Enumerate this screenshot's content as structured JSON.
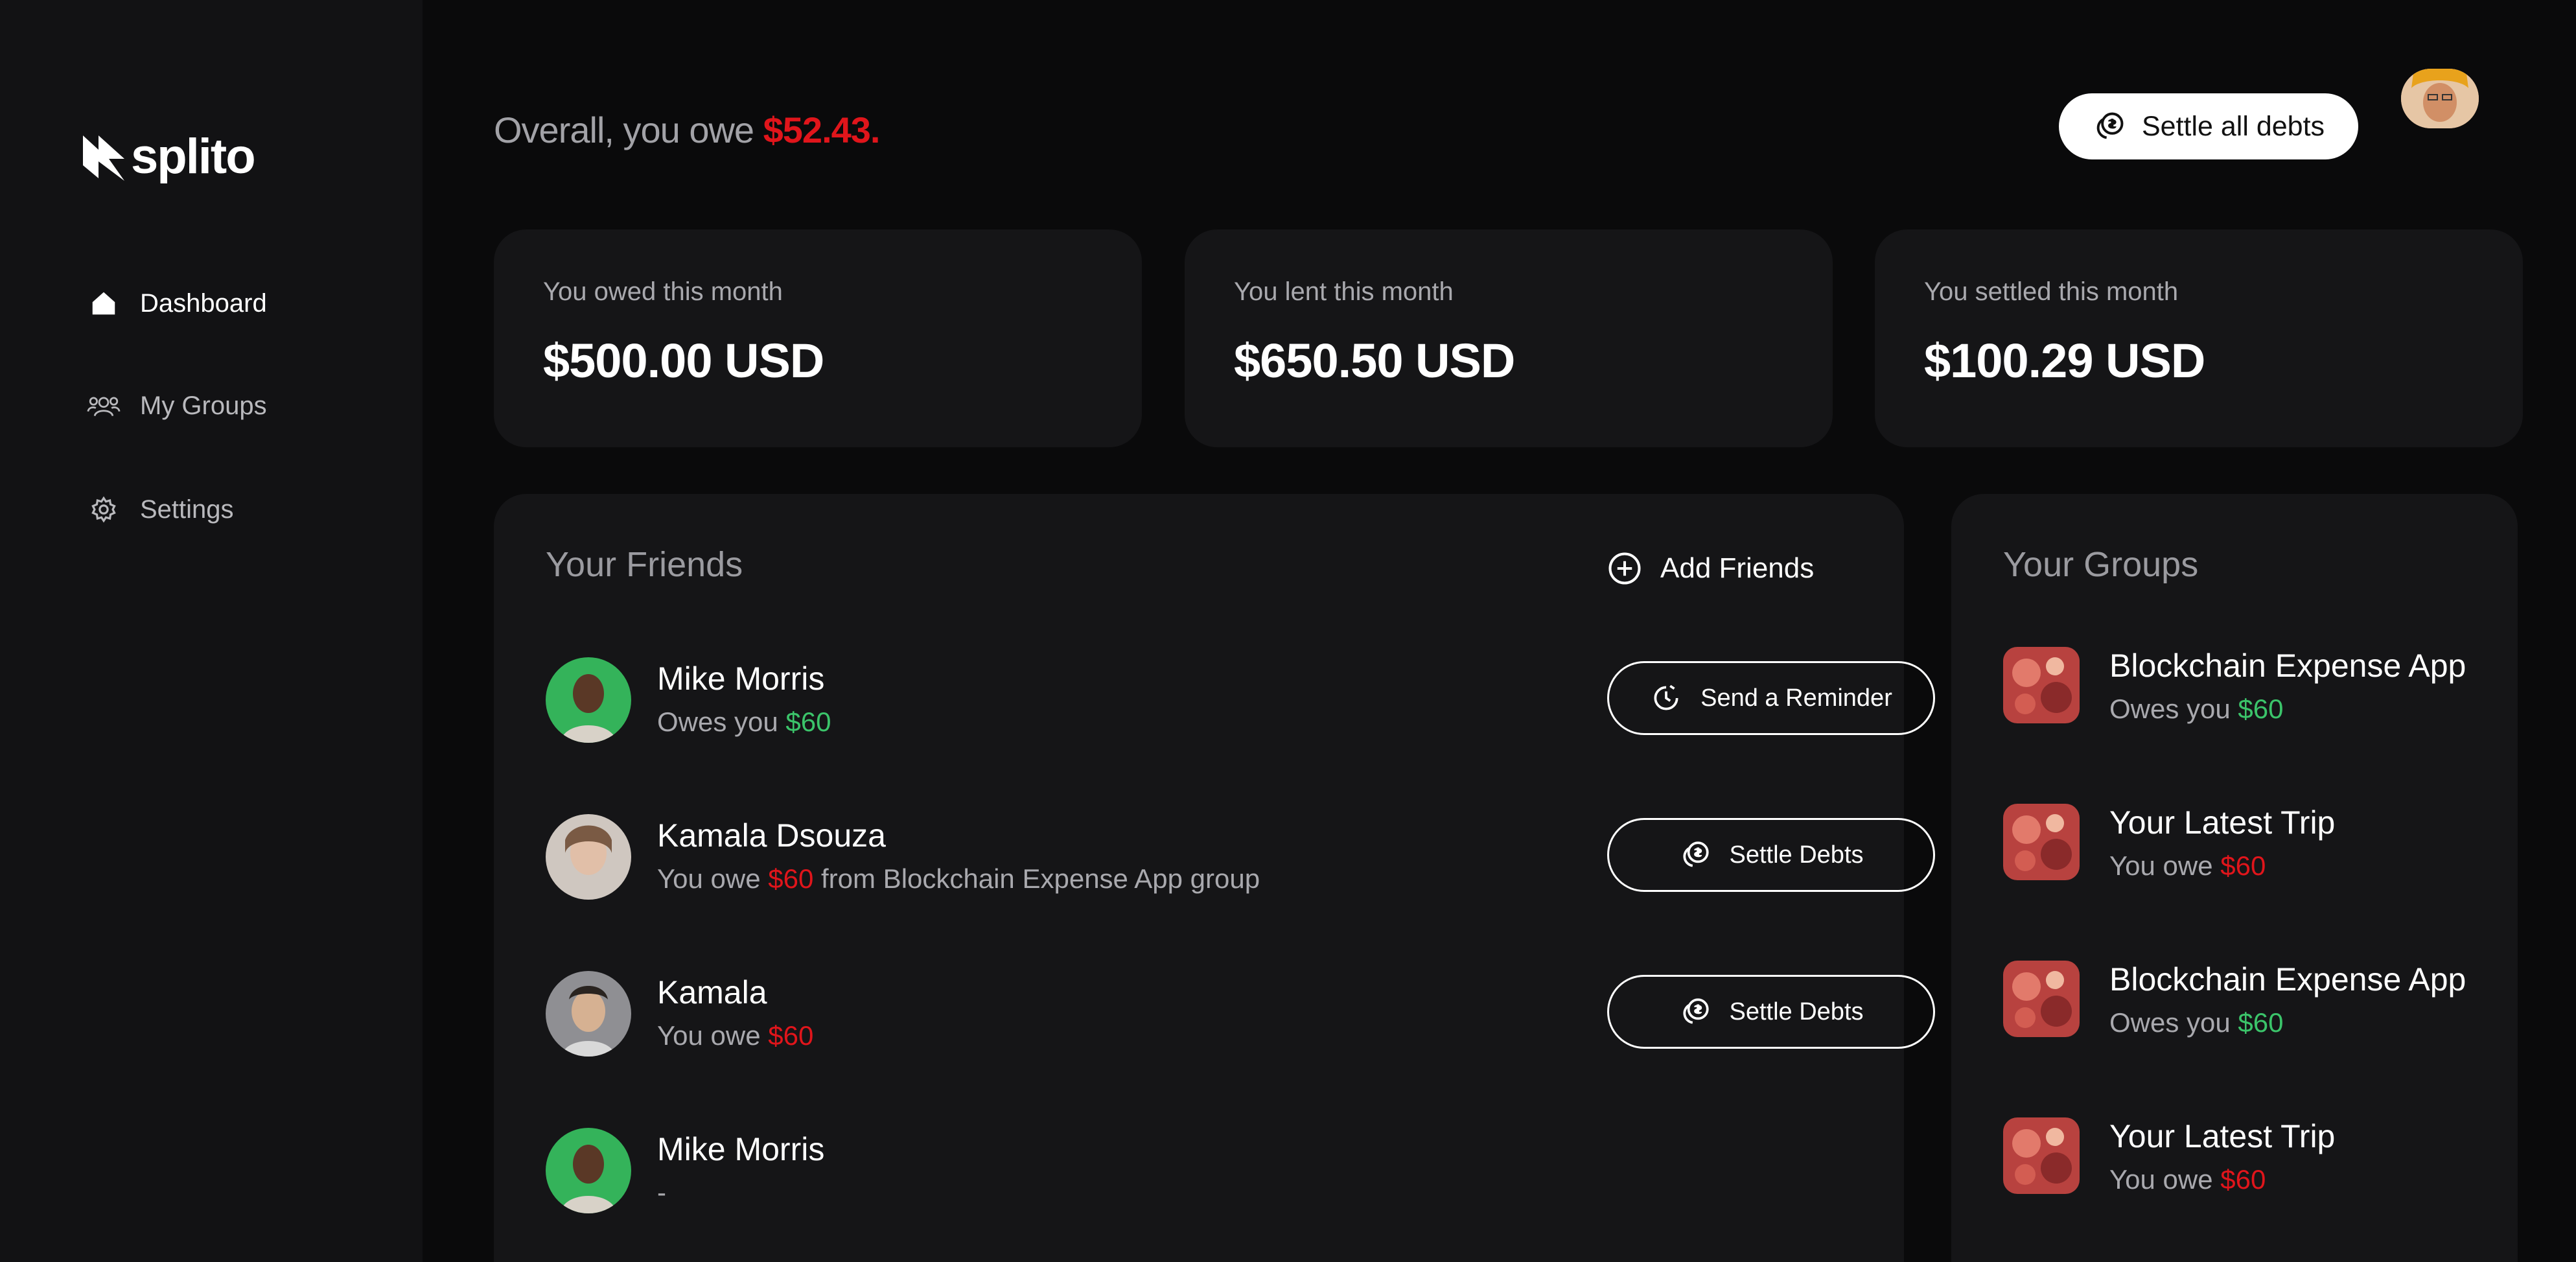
{
  "app": {
    "logo_text": "splito"
  },
  "sidebar": {
    "items": [
      {
        "label": "Dashboard",
        "icon": "home-icon",
        "active": true
      },
      {
        "label": "My Groups",
        "icon": "users-icon",
        "active": false
      },
      {
        "label": "Settings",
        "icon": "gear-icon",
        "active": false
      }
    ]
  },
  "header": {
    "overall_prefix": "Overall, you owe ",
    "overall_amount": "$52.43.",
    "settle_all_label": "Settle all debts",
    "settle_all_icon": "coins-icon"
  },
  "stats": [
    {
      "label": "You owed this month",
      "value": "$500.00 USD"
    },
    {
      "label": "You lent this month",
      "value": "$650.50 USD"
    },
    {
      "label": "You settled this month",
      "value": "$100.29 USD"
    }
  ],
  "friends": {
    "title": "Your Friends",
    "add_label": "Add Friends",
    "add_icon": "plus-circle-icon",
    "items": [
      {
        "name": "Mike Morris",
        "prefix": "Owes you ",
        "amount": "$60",
        "suffix": "",
        "amount_color": "#3bc46a",
        "action": "Send a Reminder",
        "action_icon": "clock-icon"
      },
      {
        "name": "Kamala Dsouza",
        "prefix": "You owe ",
        "amount": "$60",
        "suffix": " from Blockchain Expense App group",
        "amount_color": "#e0151b",
        "action": "Settle Debts",
        "action_icon": "coins-icon"
      },
      {
        "name": "Kamala",
        "prefix": "You owe ",
        "amount": "$60",
        "suffix": "",
        "amount_color": "#e0151b",
        "action": "Settle Debts",
        "action_icon": "coins-icon"
      },
      {
        "name": "Mike Morris",
        "prefix": "-",
        "amount": "",
        "suffix": "",
        "amount_color": "#a9a9ae",
        "action": "",
        "action_icon": ""
      }
    ]
  },
  "groups": {
    "title": "Your Groups",
    "items": [
      {
        "name": "Blockchain Expense App",
        "prefix": "Owes you ",
        "amount": "$60"
      },
      {
        "name": "Your Latest Trip",
        "prefix": "You owe ",
        "amount": "$60"
      },
      {
        "name": "Blockchain Expense App",
        "prefix": "Owes you ",
        "amount": "$60"
      },
      {
        "name": "Your Latest Trip",
        "prefix": "You owe ",
        "amount": "$60"
      }
    ]
  },
  "colors": {
    "accent_red": "#e0151b",
    "accent_green": "#3bc46a",
    "background": "#0a0a0b",
    "card": "#151517"
  }
}
